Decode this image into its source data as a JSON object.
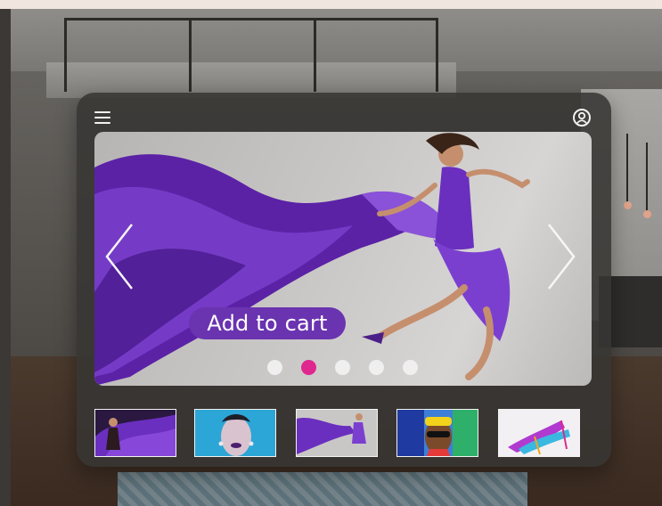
{
  "hero": {
    "cta_label": "Add to cart",
    "slide_count": 5,
    "active_slide": 2
  },
  "icons": {
    "menu": "hamburger-menu-icon",
    "account": "account-icon",
    "prev": "chevron-left-icon",
    "next": "chevron-right-icon"
  },
  "thumbnails": [
    {
      "name": "thumbnail-purple-fabric-model"
    },
    {
      "name": "thumbnail-blue-portrait"
    },
    {
      "name": "thumbnail-purple-dress-jump"
    },
    {
      "name": "thumbnail-colorful-sunglasses"
    },
    {
      "name": "thumbnail-colorful-heels"
    }
  ],
  "colors": {
    "accent": "#6a33b0",
    "active_dot": "#e0268f",
    "panel": "#373533"
  }
}
